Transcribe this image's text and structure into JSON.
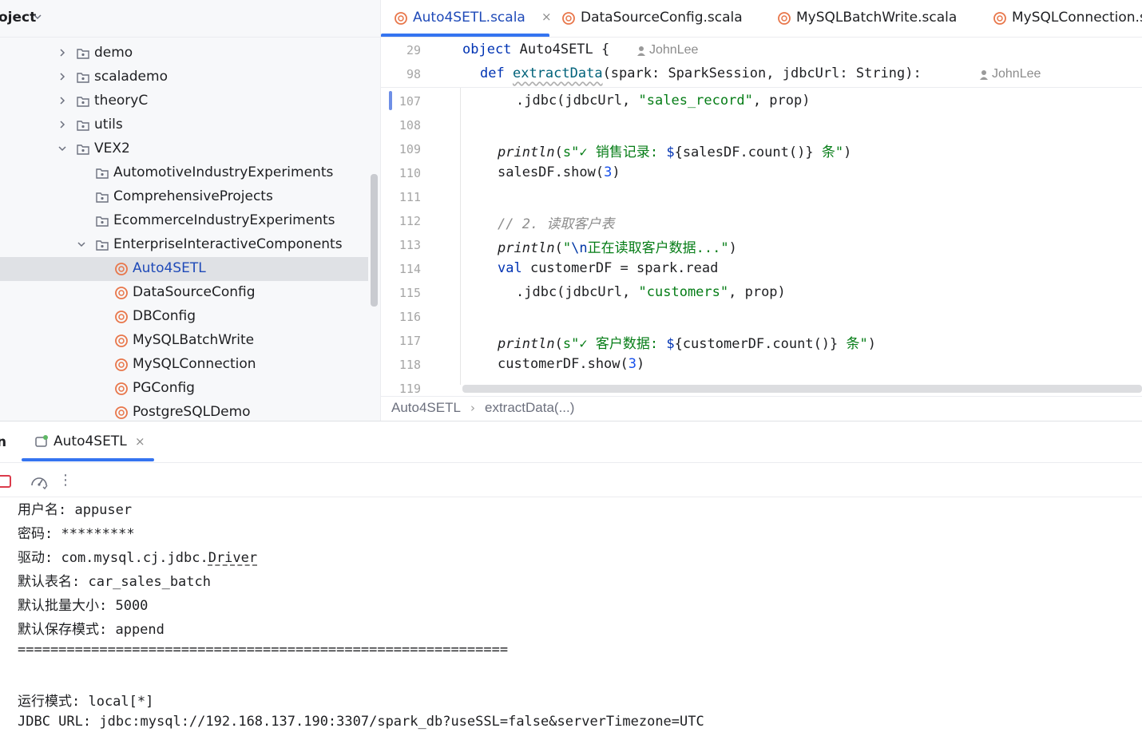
{
  "project": {
    "title": "oject",
    "tree": [
      {
        "label": "demo",
        "type": "package",
        "expanded": false
      },
      {
        "label": "scalademo",
        "type": "package",
        "expanded": false
      },
      {
        "label": "theoryC",
        "type": "package",
        "expanded": false
      },
      {
        "label": "utils",
        "type": "package",
        "expanded": false
      },
      {
        "label": "VEX2",
        "type": "package",
        "expanded": true
      },
      {
        "label": "AutomotiveIndustryExperiments",
        "type": "package"
      },
      {
        "label": "ComprehensiveProjects",
        "type": "package"
      },
      {
        "label": "EcommerceIndustryExperiments",
        "type": "package"
      },
      {
        "label": "EnterpriseInteractiveComponents",
        "type": "package",
        "expanded": true
      },
      {
        "label": "Auto4SETL",
        "type": "scala-object",
        "selected": true
      },
      {
        "label": "DataSourceConfig",
        "type": "scala-object"
      },
      {
        "label": "DBConfig",
        "type": "scala-object"
      },
      {
        "label": "MySQLBatchWrite",
        "type": "scala-object"
      },
      {
        "label": "MySQLConnection",
        "type": "scala-object"
      },
      {
        "label": "PGConfig",
        "type": "scala-object"
      },
      {
        "label": "PostgreSQLDemo",
        "type": "scala-object"
      }
    ]
  },
  "editor_tabs": [
    {
      "label": "Auto4SETL.scala",
      "active": true,
      "close": "×"
    },
    {
      "label": "DataSourceConfig.scala"
    },
    {
      "label": "MySQLBatchWrite.scala"
    },
    {
      "label": "MySQLConnection.s"
    }
  ],
  "editor": {
    "sticky": [
      {
        "num": "29",
        "kw": "object",
        "rest": " Auto4SETL {",
        "author": "JohnLee"
      },
      {
        "num": "98",
        "kw": "def",
        "fn": "extractData",
        "rest": "(spark: SparkSession, jdbcUrl: String):",
        "author": "JohnLee"
      }
    ],
    "lines": {
      "l107": {
        "num": "107",
        "a": ".jdbc(jdbcUrl, ",
        "s": "\"sales_record\"",
        "b": ", prop)"
      },
      "l108": {
        "num": "108"
      },
      "l109": {
        "num": "109",
        "fn": "println",
        "a": "(",
        "s1": "s\"✓ 销售记录: ",
        "d": "$",
        "e": "{salesDF.count()}",
        "s2": " 条\"",
        "b": ")"
      },
      "l110": {
        "num": "110",
        "a": "salesDF.show(",
        "n": "3",
        "b": ")"
      },
      "l111": {
        "num": "111"
      },
      "l112": {
        "num": "112",
        "c": "// 2. 读取客户表"
      },
      "l113": {
        "num": "113",
        "fn": "println",
        "a": "(",
        "s1": "\"",
        "esc": "\\n",
        "s2": "正在读取客户数据...\"",
        "b": ")"
      },
      "l114": {
        "num": "114",
        "kw": "val",
        "a": " customerDF = spark.read"
      },
      "l115": {
        "num": "115",
        "a": ".jdbc(jdbcUrl, ",
        "s": "\"customers\"",
        "b": ", prop)"
      },
      "l116": {
        "num": "116"
      },
      "l117": {
        "num": "117",
        "fn": "println",
        "a": "(",
        "s1": "s\"✓ 客户数据: ",
        "d": "$",
        "e": "{customerDF.count()}",
        "s2": " 条\"",
        "b": ")"
      },
      "l118": {
        "num": "118",
        "a": "customerDF.show(",
        "n": "3",
        "b": ")"
      },
      "l119": {
        "num": "119"
      }
    }
  },
  "breadcrumb": {
    "file": "Auto4SETL",
    "sep": "›",
    "method": "extractData(...)"
  },
  "run": {
    "title": "n",
    "tab_label": "Auto4SETL",
    "tab_close": "×",
    "more": "⋮",
    "console": [
      "用户名: appuser",
      "密码: *********",
      {
        "prefix": "驱动: com.mysql.cj.jdbc.",
        "link": "Driver"
      },
      "默认表名: car_sales_batch",
      "默认批量大小: 5000",
      "默认保存模式: append",
      "============================================================",
      "",
      "运行模式: local[*]",
      "JDBC URL: jdbc:mysql://192.168.137.190:3307/spark_db?useSSL=false&serverTimezone=UTC"
    ]
  },
  "colors": {
    "accent": "#3574f0",
    "selection": "#dfe1e5",
    "keyword": "#0033b3",
    "string": "#067d17",
    "number": "#1750eb"
  }
}
